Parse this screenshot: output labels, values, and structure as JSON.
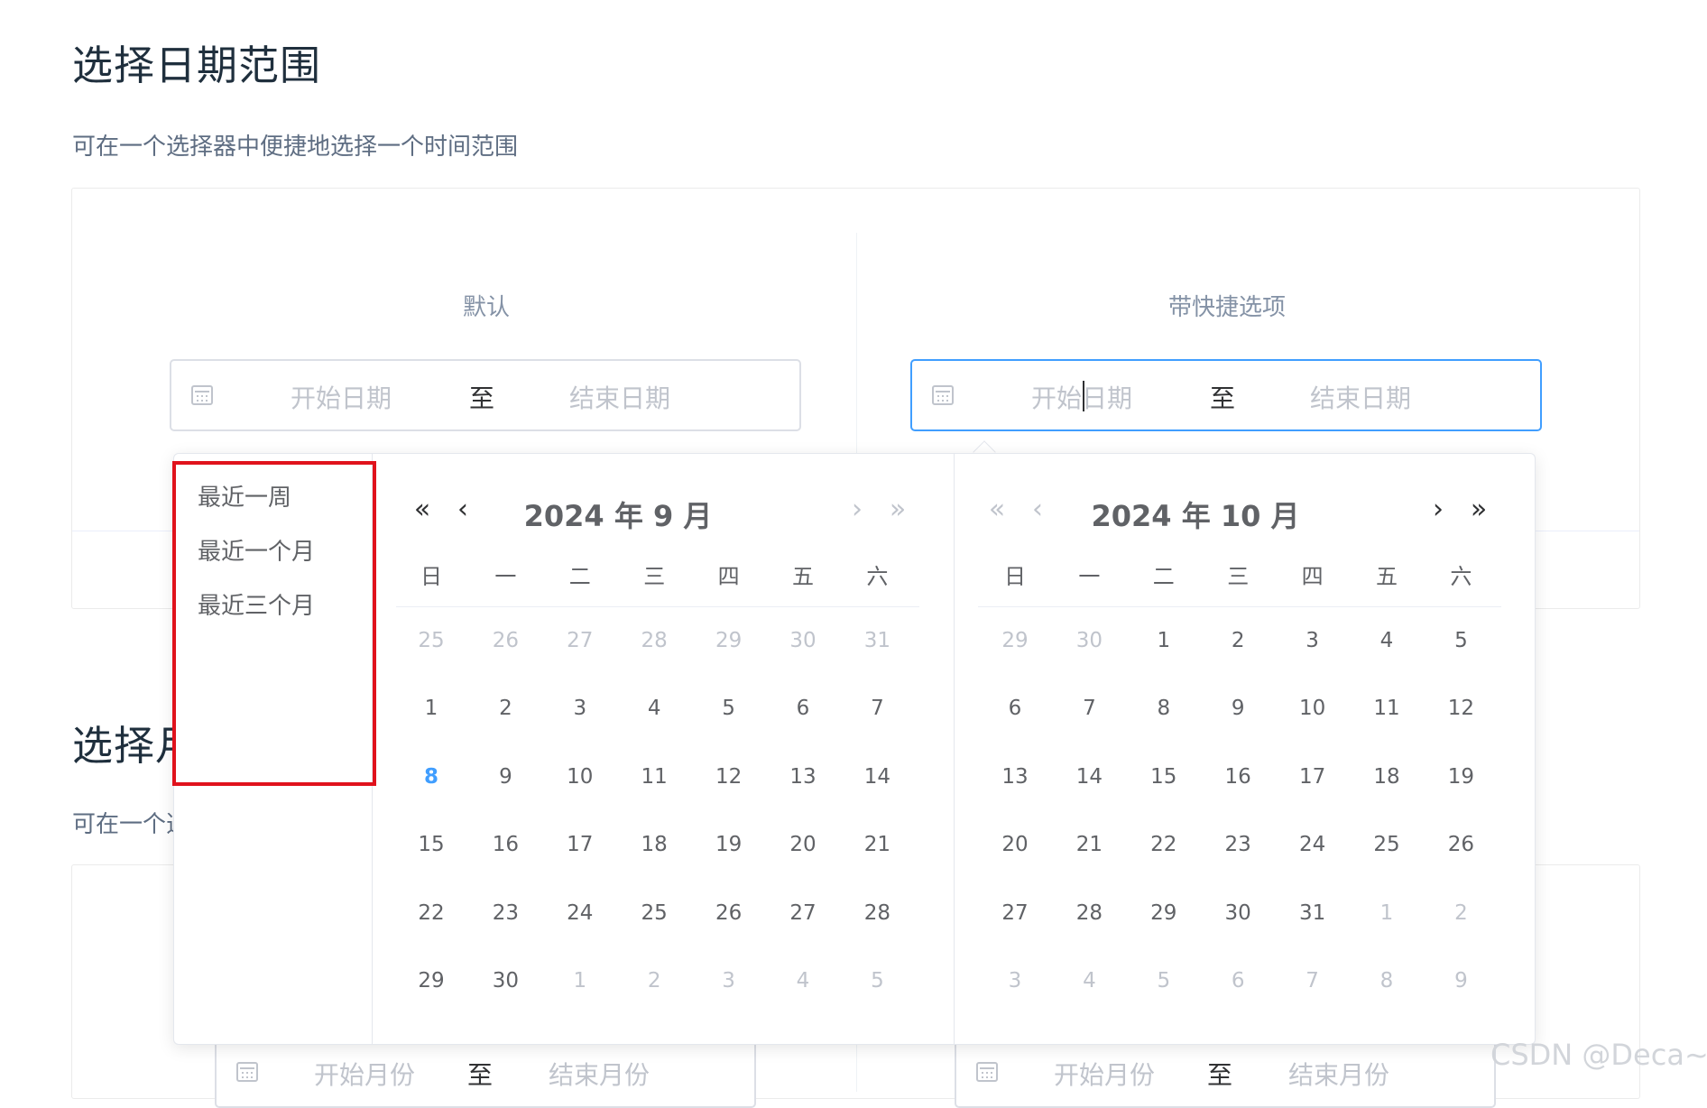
{
  "page": {
    "title": "选择日期范围",
    "description": "可在一个选择器中便捷地选择一个时间范围",
    "next_title": "选择月份范围",
    "next_description": "可在一个选择器中便捷地选择一个月份范围"
  },
  "demo": {
    "left_label": "默认",
    "right_label": "带快捷选项"
  },
  "date_range": {
    "start_placeholder": "开始日期",
    "separator": "至",
    "end_placeholder": "结束日期"
  },
  "month_range": {
    "start_placeholder": "开始月份",
    "separator": "至",
    "end_placeholder": "结束月份"
  },
  "shortcuts": [
    "最近一周",
    "最近一个月",
    "最近三个月"
  ],
  "weekdays": [
    "日",
    "一",
    "二",
    "三",
    "四",
    "五",
    "六"
  ],
  "calendars": [
    {
      "header": "2024 年 9 月",
      "nav_prev_year": "«",
      "nav_prev_month": "‹",
      "nav_next_month": "›",
      "nav_next_year": "»",
      "days": [
        [
          "25",
          "26",
          "27",
          "28",
          "29",
          "30",
          "31"
        ],
        [
          "1",
          "2",
          "3",
          "4",
          "5",
          "6",
          "7"
        ],
        [
          "8",
          "9",
          "10",
          "11",
          "12",
          "13",
          "14"
        ],
        [
          "15",
          "16",
          "17",
          "18",
          "19",
          "20",
          "21"
        ],
        [
          "22",
          "23",
          "24",
          "25",
          "26",
          "27",
          "28"
        ],
        [
          "29",
          "30",
          "1",
          "2",
          "3",
          "4",
          "5"
        ]
      ]
    },
    {
      "header": "2024 年 10 月",
      "nav_prev_year": "«",
      "nav_prev_month": "‹",
      "nav_next_month": "›",
      "nav_next_year": "»",
      "days": [
        [
          "29",
          "30",
          "1",
          "2",
          "3",
          "4",
          "5"
        ],
        [
          "6",
          "7",
          "8",
          "9",
          "10",
          "11",
          "12"
        ],
        [
          "13",
          "14",
          "15",
          "16",
          "17",
          "18",
          "19"
        ],
        [
          "20",
          "21",
          "22",
          "23",
          "24",
          "25",
          "26"
        ],
        [
          "27",
          "28",
          "29",
          "30",
          "31",
          "1",
          "2"
        ],
        [
          "3",
          "4",
          "5",
          "6",
          "7",
          "8",
          "9"
        ]
      ]
    }
  ],
  "watermark": "CSDN @Deca~",
  "colors": {
    "accent": "#409eff",
    "highlight_box": "#e0121c",
    "muted_text": "#c0c4cc"
  }
}
